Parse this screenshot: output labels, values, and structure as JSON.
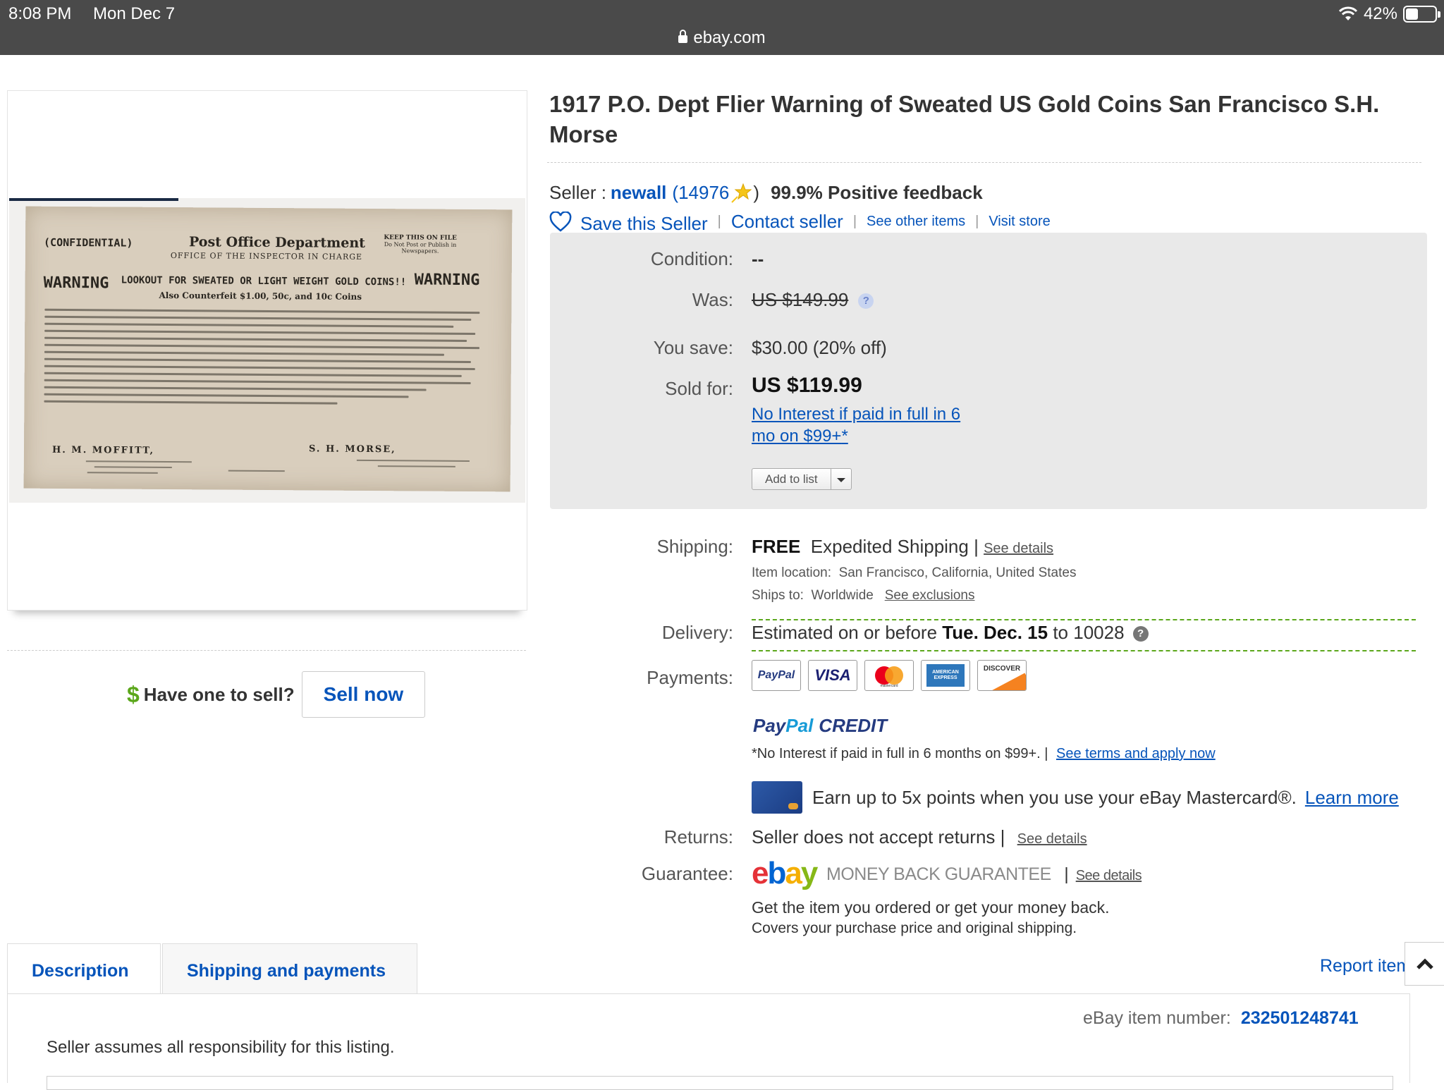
{
  "status_bar": {
    "time": "8:08 PM",
    "date": "Mon Dec 7",
    "battery": "42%",
    "battery_level": 0.42
  },
  "url_bar": {
    "domain": "ebay.com"
  },
  "flier": {
    "confidential": "(CONFIDENTIAL)",
    "dept": "Post Office Department",
    "office": "OFFICE OF THE INSPECTOR IN CHARGE",
    "keep": "KEEP THIS ON FILE",
    "keep_sub": "Do Not Post or Publish in Newspapers.",
    "warning": "WARNING",
    "lookout": "LOOKOUT FOR SWEATED OR LIGHT WEIGHT GOLD COINS!!",
    "also": "Also Counterfeit $1.00, 50c, and 10c Coins",
    "sig1": "H. M. MOFFITT,",
    "sig2": "S. H. MORSE,"
  },
  "sell": {
    "prompt": "Have one to sell?",
    "button": "Sell now",
    "dollar": "$"
  },
  "listing": {
    "title": "1917 P.O. Dept Flier Warning of Sweated US Gold Coins San Francisco S.H. Morse",
    "seller_prefix": "Seller :",
    "seller_name": "newall",
    "seller_score": "14976",
    "feedback": "99.9% Positive feedback",
    "save_seller": "Save this Seller",
    "contact_seller": "Contact seller",
    "see_other": "See other items",
    "visit_store": "Visit store"
  },
  "buybox": {
    "condition_label": "Condition:",
    "condition_value": "--",
    "was_label": "Was:",
    "was_value": "US $149.99",
    "save_label": "You save:",
    "save_value": "$30.00 (20% off)",
    "sold_label": "Sold for:",
    "sold_value": "US $119.99",
    "no_interest_1": "No Interest if paid in full in 6",
    "no_interest_2": "mo on $99+",
    "add_to_list": "Add to list"
  },
  "shipping": {
    "label": "Shipping:",
    "free": "FREE",
    "method": "Expedited Shipping |",
    "see_details": "See details",
    "location_label": "Item location:",
    "location": "San Francisco, California, United States",
    "ships_to_label": "Ships to:",
    "ships_to": "Worldwide",
    "see_exclusions": "See exclusions"
  },
  "delivery": {
    "label": "Delivery:",
    "prefix": "Estimated on or before",
    "date": "Tue. Dec. 15",
    "suffix": "to 10028"
  },
  "payments": {
    "label": "Payments:",
    "logos": [
      "PayPal",
      "VISA",
      "mastercard",
      "AMERICAN EXPRESS",
      "DISCOVER"
    ],
    "paypal_credit_1": "Pay",
    "paypal_credit_2": "Pal",
    "paypal_credit_3": "CREDIT",
    "credit_note": "*No Interest if paid in full in 6 months on $99+.  |",
    "credit_link": "See terms and apply now",
    "mc_text": "Earn up to 5x points when you use your eBay Mastercard®.",
    "mc_link": "Learn more"
  },
  "returns": {
    "label": "Returns:",
    "value": "Seller does not accept returns |",
    "see_details": "See details"
  },
  "guarantee": {
    "label": "Guarantee:",
    "mbg": "MONEY BACK GUARANTEE",
    "see_details": "See details",
    "line1": "Get the item you ordered or get your money back.",
    "line2": "Covers your purchase price and original shipping."
  },
  "tabs": {
    "description": "Description",
    "shipping": "Shipping and payments",
    "report": "Report item"
  },
  "description": {
    "item_number_label": "eBay item number:",
    "item_number": "232501248741",
    "responsibility": "Seller assumes all responsibility for this listing."
  },
  "colors": {
    "link": "#0654ba",
    "accent_green": "#5ba71b",
    "topbar": "#4a4a4a"
  }
}
